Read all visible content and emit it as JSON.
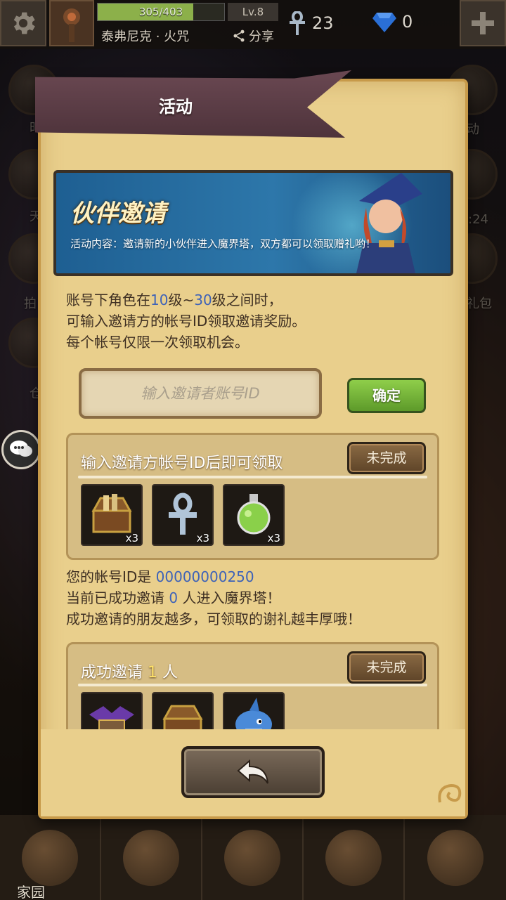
{
  "topbar": {
    "exp_text": "305/403",
    "exp_fraction": 0.757,
    "level": "Lv.8",
    "player_name": "泰弗尼克 · 火咒",
    "share_label": "分享",
    "ankh_count": "23",
    "gem_count": "0"
  },
  "background": {
    "side_labels": [
      "时",
      "天",
      "拍",
      "仓",
      "动",
      ":24",
      "礼包"
    ]
  },
  "panel": {
    "title": "活动",
    "banner": {
      "title": "伙伴邀请",
      "description": "活动内容：邀请新的小伙伴进入魔界塔，双方都可以领取赠礼哟！"
    },
    "rules": {
      "line1_a": "账号下角色在",
      "line1_b": "10",
      "line1_c": "级~",
      "line1_d": "30",
      "line1_e": "级之间时，",
      "line2": "可输入邀请方的帐号ID领取邀请奖励。",
      "line3": "每个帐号仅限一次领取机会。"
    },
    "invite_input": {
      "placeholder": "输入邀请者账号ID",
      "value": ""
    },
    "confirm_label": "确定",
    "reward1": {
      "title": "输入邀请方帐号ID后即可领取",
      "status": "未完成",
      "items": [
        {
          "icon": "treasure-chest-icon",
          "qty": "x3"
        },
        {
          "icon": "ankh-icon",
          "qty": "x3"
        },
        {
          "icon": "green-potion-icon",
          "qty": "x3"
        }
      ]
    },
    "info": {
      "id_prefix": "您的帐号ID是 ",
      "id_value": "00000000250",
      "line2_a": "当前已成功邀请 ",
      "line2_b": "0",
      "line2_c": " 人进入魔界塔！",
      "line3": "成功邀请的朋友越多，可领取的谢礼越丰厚哦！"
    },
    "reward2": {
      "title_a": "成功邀请 ",
      "title_b": "1",
      "title_c": " 人",
      "status": "未完成",
      "items": [
        {
          "icon": "bat-crate-icon"
        },
        {
          "icon": "treasure-chest-icon"
        },
        {
          "icon": "shark-pet-icon"
        }
      ]
    }
  },
  "bottom_nav": {
    "home_label": "家园"
  },
  "colors": {
    "panel_bg": "#e9cf8c",
    "highlight_blue": "#3d62b8",
    "confirm_green": "#8fce4a",
    "ribbon": "#5a3d45"
  }
}
